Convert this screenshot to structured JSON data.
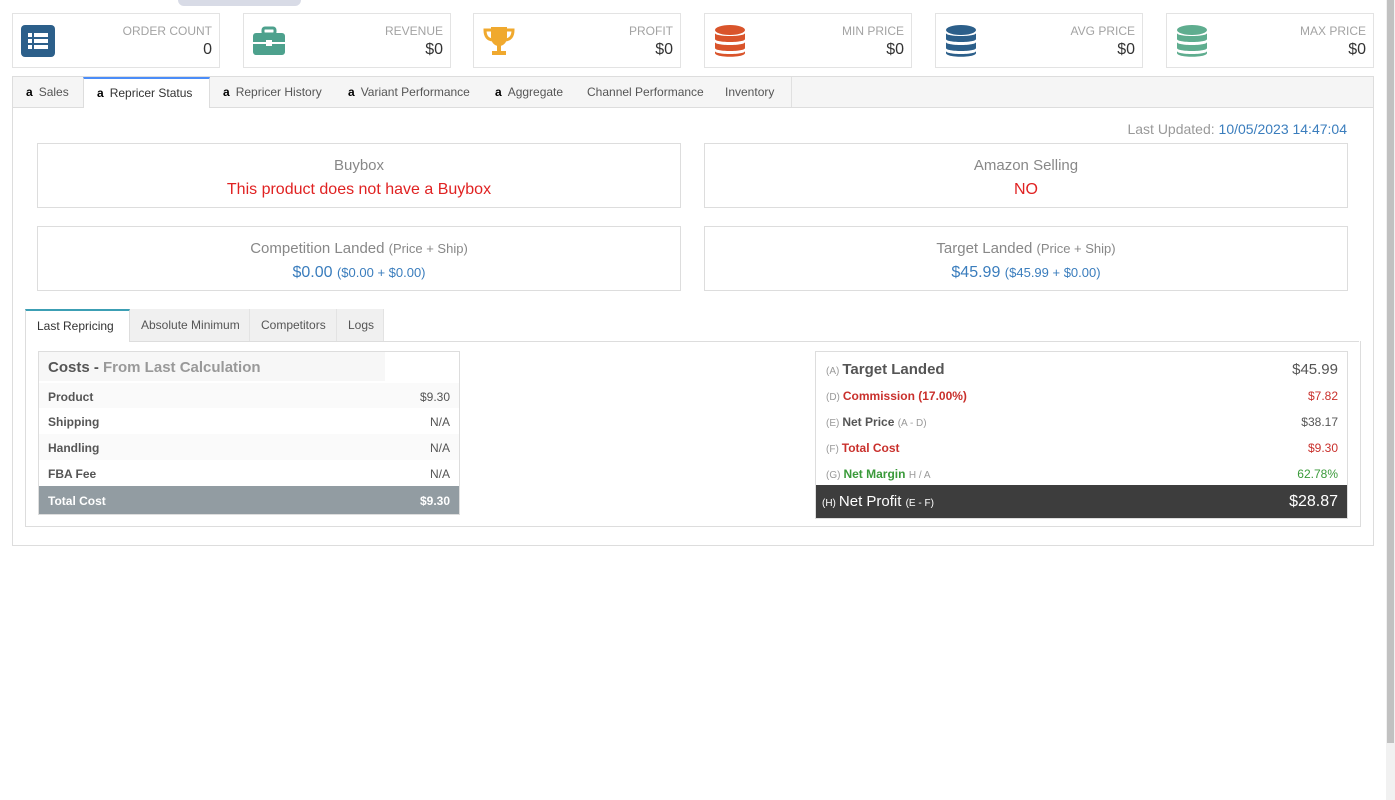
{
  "stats": [
    {
      "label": "ORDER COUNT",
      "value": "0",
      "icon": "list-icon",
      "color": "#2c5f8a"
    },
    {
      "label": "REVENUE",
      "value": "$0",
      "icon": "briefcase-icon",
      "color": "#4da18d"
    },
    {
      "label": "PROFIT",
      "value": "$0",
      "icon": "trophy-icon",
      "color": "#f0a92e"
    },
    {
      "label": "MIN PRICE",
      "value": "$0",
      "icon": "database-icon",
      "color": "#d9542b"
    },
    {
      "label": "AVG PRICE",
      "value": "$0",
      "icon": "database-icon",
      "color": "#2c5f8a"
    },
    {
      "label": "MAX PRICE",
      "value": "$0",
      "icon": "database-icon",
      "color": "#5fad8f"
    }
  ],
  "tabs": [
    {
      "label": "Sales",
      "amazon": true
    },
    {
      "label": "Repricer Status",
      "amazon": true,
      "active": true
    },
    {
      "label": "Repricer History",
      "amazon": true
    },
    {
      "label": "Variant Performance",
      "amazon": true
    },
    {
      "label": "Aggregate",
      "amazon": true
    },
    {
      "label": "Channel Performance",
      "amazon": false
    },
    {
      "label": "Inventory",
      "amazon": false
    }
  ],
  "amazon_glyph": "a",
  "last_updated": {
    "label": "Last Updated:",
    "value": "10/05/2023 14:47:04"
  },
  "buybox": {
    "title": "Buybox",
    "value": "This product does not have a Buybox"
  },
  "amazon_selling": {
    "title": "Amazon Selling",
    "value": "NO"
  },
  "competition_landed": {
    "title": "Competition Landed",
    "hint": "(Price + Ship)",
    "value": "$0.00",
    "detail": "($0.00 + $0.00)"
  },
  "target_landed_box": {
    "title": "Target Landed",
    "hint": "(Price + Ship)",
    "value": "$45.99",
    "detail": "($45.99 + $0.00)"
  },
  "subtabs": [
    {
      "label": "Last Repricing",
      "active": true
    },
    {
      "label": "Absolute Minimum"
    },
    {
      "label": "Competitors"
    },
    {
      "label": "Logs"
    }
  ],
  "costs": {
    "title": "Costs -",
    "subtitle": "From Last Calculation",
    "rows": [
      {
        "label": "Product",
        "value": "$9.30"
      },
      {
        "label": "Shipping",
        "value": "N/A"
      },
      {
        "label": "Handling",
        "value": "N/A"
      },
      {
        "label": "FBA Fee",
        "value": "N/A"
      }
    ],
    "total": {
      "label": "Total Cost",
      "value": "$9.30"
    }
  },
  "calculation": {
    "target_landed": {
      "code": "(A)",
      "label": "Target Landed",
      "value": "$45.99"
    },
    "commission": {
      "code": "(D)",
      "label": "Commission (17.00%)",
      "value": "$7.82"
    },
    "net_price": {
      "code": "(E)",
      "label": "Net Price",
      "formula": "(A - D)",
      "value": "$38.17"
    },
    "total_cost": {
      "code": "(F)",
      "label": "Total Cost",
      "value": "$9.30"
    },
    "net_margin": {
      "code": "(G)",
      "label": "Net Margin",
      "formula": "H / A",
      "value": "62.78%"
    },
    "net_profit": {
      "code": "(H)",
      "label": "Net Profit",
      "formula": "(E - F)",
      "value": "$28.87"
    }
  }
}
